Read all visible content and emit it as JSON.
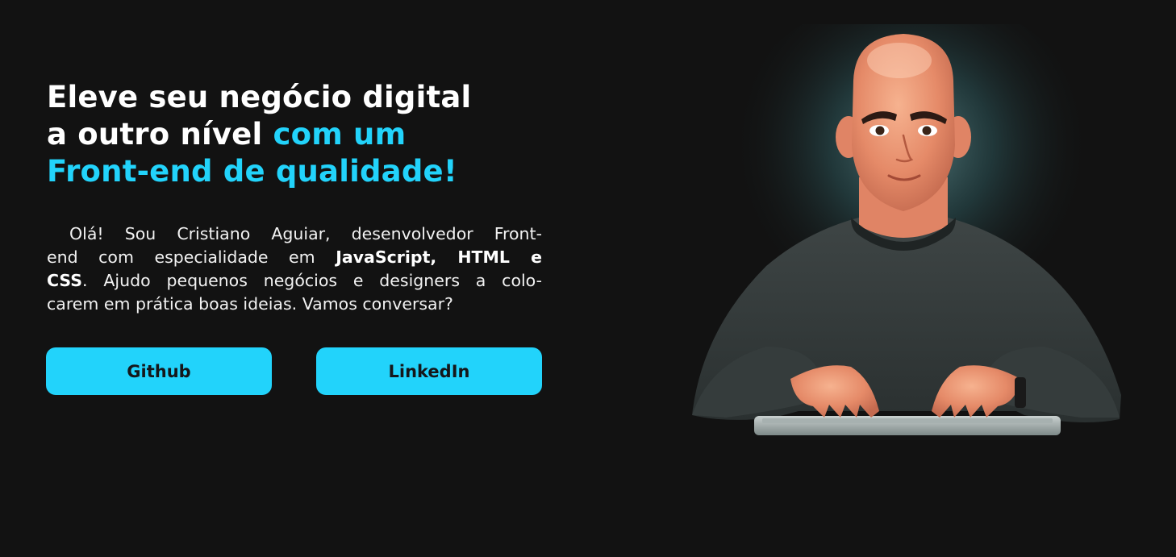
{
  "hero": {
    "headline": {
      "line1": "Eleve seu negócio digital",
      "line2_plain": "a outro nível ",
      "line2_accent": "com um",
      "line3_accent": "Front-end de qualidade!"
    },
    "intro": {
      "line1": "Olá! Sou Cristiano Aguiar, desenvolvedor Front-",
      "line2_plain": "end com especialidade em ",
      "line2_bold": "JavaScript, HTML e",
      "line3_bold": "CSS",
      "line3_plain": ". Ajudo pequenos negócios e designers a colo-",
      "line4": "carem em prática boas ideias. Vamos conversar?"
    },
    "buttons": {
      "github": "Github",
      "linkedin": "LinkedIn"
    }
  },
  "portrait": {
    "icon": "developer-avatar-illustration"
  },
  "colors": {
    "background": "#121212",
    "accent": "#22d3fb",
    "text": "#ffffff",
    "button_text": "#15171a"
  }
}
